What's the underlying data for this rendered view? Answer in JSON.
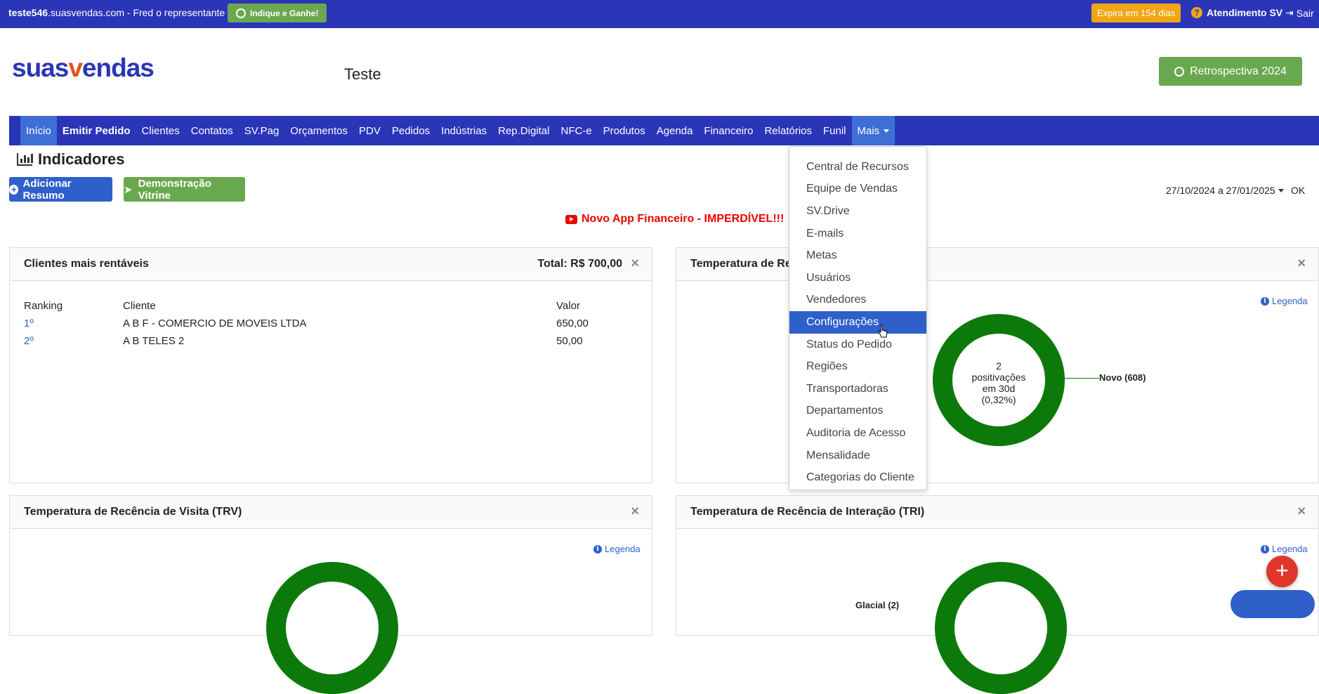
{
  "topbar": {
    "site_bold": "teste546",
    "site_rest": ".suasvendas.com - Fred o representante",
    "indique_label": "Indique e Ganhe!",
    "expira_label": "Expira em 154 dias",
    "atendimento_label": "Atendimento SV",
    "sair_label": "Sair"
  },
  "header": {
    "logo_a": "suas",
    "logo_v": "v",
    "logo_b": "endas",
    "company": "Teste",
    "retro_label": "Retrospectiva 2024"
  },
  "nav": {
    "items": [
      "Início",
      "Emitir Pedido",
      "Clientes",
      "Contatos",
      "SV.Pag",
      "Orçamentos",
      "PDV",
      "Pedidos",
      "Indústrias",
      "Rep.Digital",
      "NFC-e",
      "Produtos",
      "Agenda",
      "Financeiro",
      "Relatórios",
      "Funil",
      "Mais"
    ]
  },
  "page": {
    "title": "Indicadores",
    "add_resumo": "Adicionar Resumo",
    "demo_vitrine": "Demonstração Vitrine",
    "date_range": "27/10/2024 a 27/01/2025",
    "ok": "OK",
    "promo": "Novo App Financeiro - IMPERDÍVEL!!!"
  },
  "panel_clientes": {
    "title": "Clientes mais rentáveis",
    "total": "Total: R$ 700,00",
    "close": "×",
    "headers": [
      "Ranking",
      "Cliente",
      "Valor"
    ],
    "rows": [
      {
        "rank": "1º",
        "cliente": "A B F - COMERCIO DE MOVEIS LTDA",
        "valor": "650,00"
      },
      {
        "rank": "2º",
        "cliente": "A B TELES 2",
        "valor": "50,00"
      }
    ]
  },
  "panel_trc": {
    "title": "Temperatura de Recê",
    "close": "×",
    "legenda": "Legenda",
    "center_line1": "2",
    "center_line2": "positivações",
    "center_line3": "em 30d",
    "center_line4": "(0,32%)",
    "label_novo": "Novo (608)"
  },
  "panel_trv": {
    "title": "Temperatura de Recência de Visita (TRV)",
    "close": "×",
    "legenda": "Legenda"
  },
  "panel_tri": {
    "title": "Temperatura de Recência de Interação (TRI)",
    "close": "×",
    "legenda": "Legenda",
    "label_glacial": "Glacial (2)"
  },
  "dropdown": {
    "items": [
      "Central de Recursos",
      "Equipe de Vendas",
      "SV.Drive",
      "E-mails",
      "Metas",
      "Usuários",
      "Vendedores",
      "Configurações",
      "Status do Pedido",
      "Regiões",
      "Transportadoras",
      "Departamentos",
      "Auditoria de Acesso",
      "Mensalidade",
      "Categorias do Cliente"
    ],
    "selected": "Configurações"
  },
  "fab_label": "+",
  "colors": {
    "brand_blue": "#2a35b8",
    "accent_blue": "#2f5fc9",
    "green": "#6aa84f",
    "orange": "#f2a515",
    "donut_green": "#0b7a0b",
    "red": "#e0362c"
  }
}
